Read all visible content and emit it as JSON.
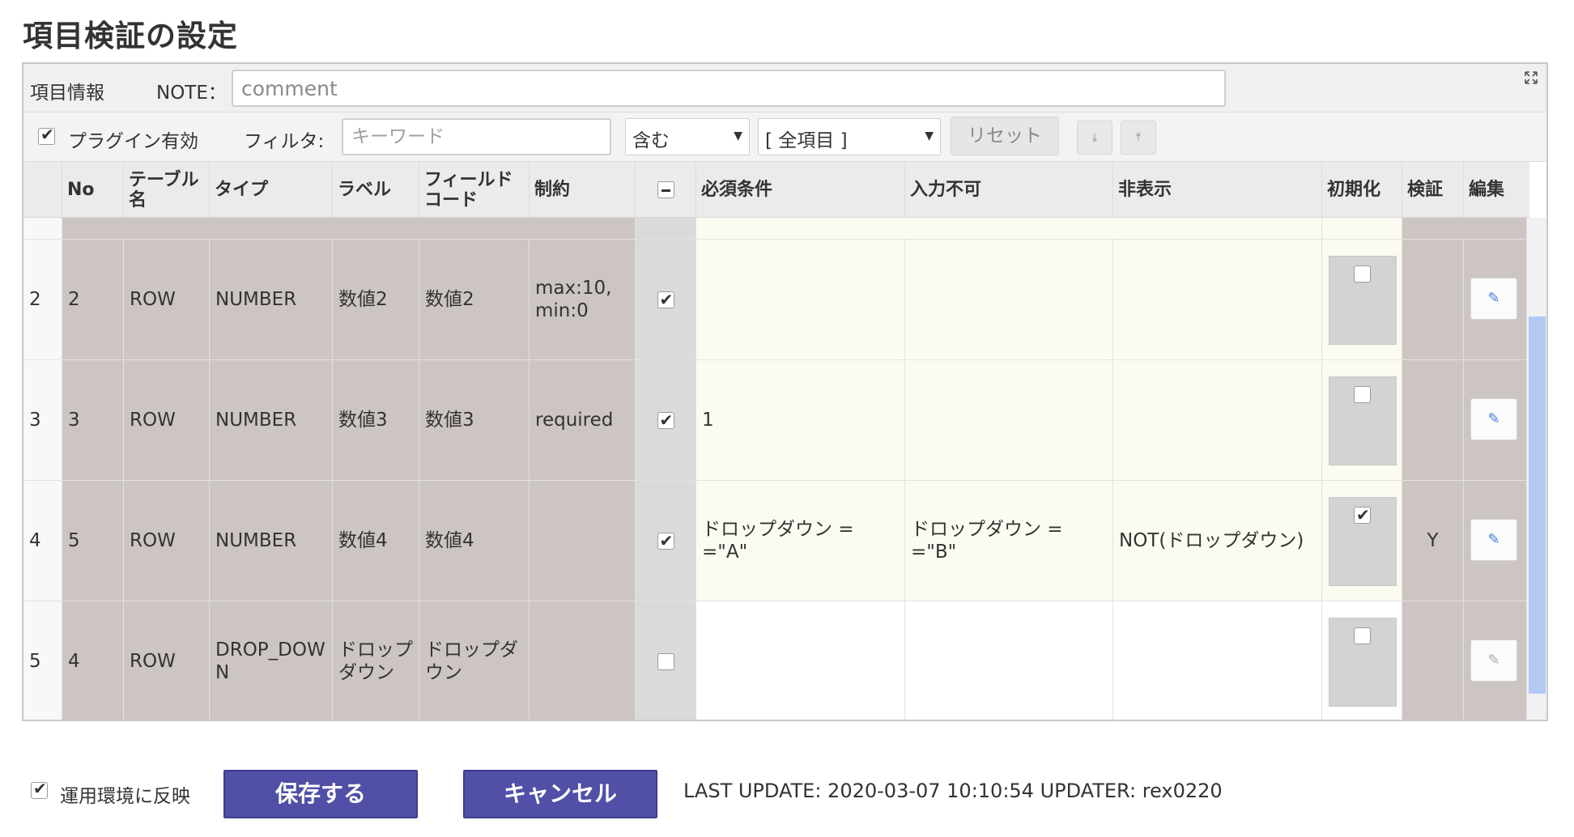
{
  "page": {
    "title": "項目検証の設定"
  },
  "info_bar": {
    "label": "項目情報",
    "note_label": "NOTE：",
    "note_placeholder": "comment",
    "note_value": ""
  },
  "filter_bar": {
    "plugin_label": "プラグイン有効",
    "plugin_checked": true,
    "filter_label": "フィルタ:",
    "keyword_placeholder": "キーワード",
    "match_select": "含む",
    "field_select": "[ 全項目 ]",
    "reset_label": "リセット"
  },
  "table": {
    "headers": {
      "no": "No",
      "table_name": "テーブル名",
      "type": "タイプ",
      "label": "ラベル",
      "field_code": "フィールドコード",
      "constraint": "制約",
      "required_cond": "必須条件",
      "readonly": "入力不可",
      "hidden": "非表示",
      "init": "初期化",
      "validate": "検証",
      "edit": "編集"
    },
    "rows": [
      {
        "index": "2",
        "no": "2",
        "table_name": "ROW",
        "type": "NUMBER",
        "label": "数値2",
        "field_code": "数値2",
        "constraint": "max:10, min:0",
        "checked": true,
        "required_cond": "",
        "readonly": "",
        "hidden": "",
        "init": false,
        "validate": "",
        "edit_enabled": true
      },
      {
        "index": "3",
        "no": "3",
        "table_name": "ROW",
        "type": "NUMBER",
        "label": "数値3",
        "field_code": "数値3",
        "constraint": "required",
        "checked": true,
        "required_cond": "1",
        "readonly": "",
        "hidden": "",
        "init": false,
        "validate": "",
        "edit_enabled": true
      },
      {
        "index": "4",
        "no": "5",
        "table_name": "ROW",
        "type": "NUMBER",
        "label": "数値4",
        "field_code": "数値4",
        "constraint": "",
        "checked": true,
        "required_cond": "ドロップダウン ==\"A\"",
        "readonly": "ドロップダウン ==\"B\"",
        "hidden": "NOT(ドロップダウン)",
        "init": true,
        "validate": "Y",
        "edit_enabled": true
      },
      {
        "index": "5",
        "no": "4",
        "table_name": "ROW",
        "type": "DROP_DOWN",
        "label": "ドロップダウン",
        "field_code": "ドロップダウン",
        "constraint": "",
        "checked": false,
        "required_cond": "",
        "readonly": "",
        "hidden": "",
        "init": false,
        "validate": "",
        "edit_enabled": false
      }
    ]
  },
  "footer": {
    "apply_label": "運用環境に反映",
    "apply_checked": true,
    "save_label": "保存する",
    "cancel_label": "キャンセル",
    "last_update": "LAST UPDATE: 2020-03-07 10:10:54 UPDATER: rex0220"
  },
  "colors": {
    "primary_button": "#5150a6",
    "edit_icon": "#3b7fd4",
    "scroll_thumb": "#b3c8f2"
  }
}
